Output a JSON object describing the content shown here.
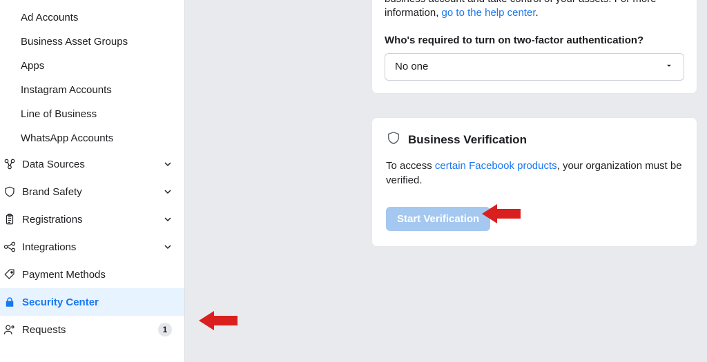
{
  "sidebar": {
    "sub_items": [
      "Ad Accounts",
      "Business Asset Groups",
      "Apps",
      "Instagram Accounts",
      "Line of Business",
      "WhatsApp Accounts"
    ],
    "nav": {
      "data_sources": "Data Sources",
      "brand_safety": "Brand Safety",
      "registrations": "Registrations",
      "integrations": "Integrations",
      "payment_methods": "Payment Methods",
      "security_center": "Security Center",
      "requests": "Requests",
      "requests_badge": "1"
    }
  },
  "tfa": {
    "body_prefix": "business account and take control of your assets. For more information, ",
    "link_text": "go to the help center",
    "period": ".",
    "question": "Who's required to turn on two-factor authentication?",
    "select_value": "No one"
  },
  "verification": {
    "title": "Business Verification",
    "desc_prefix": "To access ",
    "desc_link": "certain Facebook products",
    "desc_suffix": ", your organization must be verified.",
    "button": "Start Verification"
  }
}
